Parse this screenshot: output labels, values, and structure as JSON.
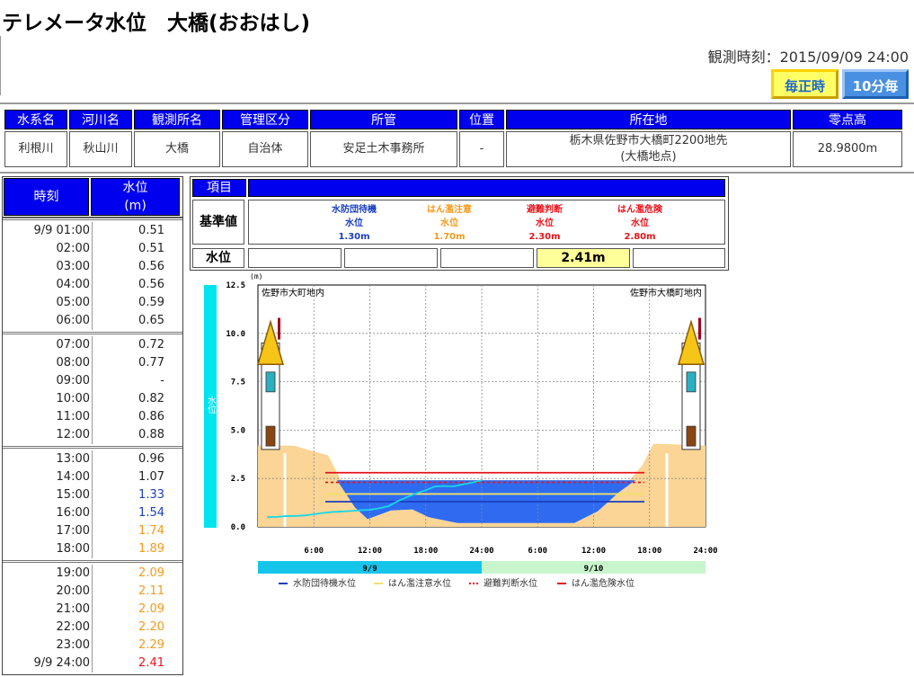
{
  "title": "テレメータ水位　大橋(おおはし)",
  "observation_time": "観測時刻：2015/09/09 24:00",
  "buttons": {
    "hourly": "毎正時",
    "ten_min": "10分毎"
  },
  "station_info": {
    "headers": [
      "水系名",
      "河川名",
      "観測所名",
      "管理区分",
      "所管",
      "位置",
      "所在地",
      "零点高"
    ],
    "values": [
      "利根川",
      "秋山川",
      "大橋",
      "自治体",
      "安足土木事務所",
      "-",
      "栃木県佐野市大橋町2200地先",
      "(大橋地点)",
      "28.9800m"
    ]
  },
  "water_table": {
    "col_time": "時刻",
    "col_level_1": "水位",
    "col_level_2": "(m)",
    "rows": [
      {
        "time": "9/9 01:00",
        "value": "0.51",
        "color": "#222222"
      },
      {
        "time": "02:00",
        "value": "0.51",
        "color": "#222222"
      },
      {
        "time": "03:00",
        "value": "0.56",
        "color": "#222222"
      },
      {
        "time": "04:00",
        "value": "0.56",
        "color": "#222222"
      },
      {
        "time": "05:00",
        "value": "0.59",
        "color": "#222222"
      },
      {
        "time": "06:00",
        "value": "0.65",
        "color": "#222222"
      },
      {
        "time": "07:00",
        "value": "0.72",
        "color": "#222222"
      },
      {
        "time": "08:00",
        "value": "0.77",
        "color": "#222222"
      },
      {
        "time": "09:00",
        "value": "-",
        "color": "#222222"
      },
      {
        "time": "10:00",
        "value": "0.82",
        "color": "#222222"
      },
      {
        "time": "11:00",
        "value": "0.86",
        "color": "#222222"
      },
      {
        "time": "12:00",
        "value": "0.88",
        "color": "#222222"
      },
      {
        "time": "13:00",
        "value": "0.96",
        "color": "#222222"
      },
      {
        "time": "14:00",
        "value": "1.07",
        "color": "#222222"
      },
      {
        "time": "15:00",
        "value": "1.33",
        "color": "#1a3fbf"
      },
      {
        "time": "16:00",
        "value": "1.54",
        "color": "#1a3fbf"
      },
      {
        "time": "17:00",
        "value": "1.74",
        "color": "#f59a1b"
      },
      {
        "time": "18:00",
        "value": "1.89",
        "color": "#f59a1b"
      },
      {
        "time": "19:00",
        "value": "2.09",
        "color": "#f59a1b"
      },
      {
        "time": "20:00",
        "value": "2.11",
        "color": "#f59a1b"
      },
      {
        "time": "21:00",
        "value": "2.09",
        "color": "#f59a1b"
      },
      {
        "time": "22:00",
        "value": "2.20",
        "color": "#f59a1b"
      },
      {
        "time": "23:00",
        "value": "2.29",
        "color": "#f59a1b"
      },
      {
        "time": "9/9 24:00",
        "value": "2.41",
        "color": "#e8141c"
      }
    ]
  },
  "criteria": {
    "item_label": "項目",
    "standard_label": "基準値",
    "level_label": "水位",
    "items": [
      {
        "name": "水防団待機",
        "sub": "水位",
        "value": "1.30m",
        "color": "#1a3fbf"
      },
      {
        "name": "はん濫注意",
        "sub": "水位",
        "value": "1.70m",
        "color": "#f59a1b"
      },
      {
        "name": "避難判断",
        "sub": "水位",
        "value": "2.30m",
        "color": "#e8141c"
      },
      {
        "name": "はん濫危険",
        "sub": "水位",
        "value": "2.80m",
        "color": "#e8141c"
      }
    ],
    "current_level": "2.41m",
    "current_highlight_color": "#ffff99"
  },
  "chart_data": {
    "type": "line",
    "unit_label": "(m)",
    "ylabel": "水位",
    "ylim": [
      0,
      12.5
    ],
    "yticks": [
      "0.0",
      "2.5",
      "5.0",
      "7.5",
      "10.0",
      "12.5"
    ],
    "xticks": [
      "6:00",
      "12:00",
      "18:00",
      "24:00",
      "6:00",
      "12:00",
      "18:00",
      "24:00"
    ],
    "left_bank_label": "佐野市大町地内",
    "right_bank_label": "佐野市大橋町地内",
    "date_bars": [
      {
        "label": "9/9",
        "color": "#16c6ea"
      },
      {
        "label": "9/10",
        "color": "#c8f5cc"
      }
    ],
    "series": [
      {
        "name": "水位",
        "color": "#16d8e8",
        "hours": [
          1,
          2,
          3,
          4,
          5,
          6,
          7,
          8,
          10,
          11,
          12,
          13,
          14,
          15,
          16,
          17,
          18,
          19,
          20,
          21,
          22,
          23,
          24
        ],
        "values": [
          0.51,
          0.51,
          0.56,
          0.56,
          0.59,
          0.65,
          0.72,
          0.77,
          0.82,
          0.86,
          0.88,
          0.96,
          1.07,
          1.33,
          1.54,
          1.74,
          1.89,
          2.09,
          2.11,
          2.09,
          2.2,
          2.29,
          2.41
        ]
      }
    ],
    "thresholds": [
      {
        "name": "水防団待機水位",
        "value": 1.3,
        "color": "#1a3fbf",
        "dash": ""
      },
      {
        "name": "はん濫注意水位",
        "value": 1.7,
        "color": "#f2e06a",
        "dash": ""
      },
      {
        "name": "避難判断水位",
        "value": 2.3,
        "color": "#e8141c",
        "dash": "3,3"
      },
      {
        "name": "はん濫危険水位",
        "value": 2.8,
        "color": "#e8141c",
        "dash": ""
      }
    ],
    "colors": {
      "bank": "#fad595",
      "water": "#2e6bf0",
      "grid": "#888888"
    }
  }
}
